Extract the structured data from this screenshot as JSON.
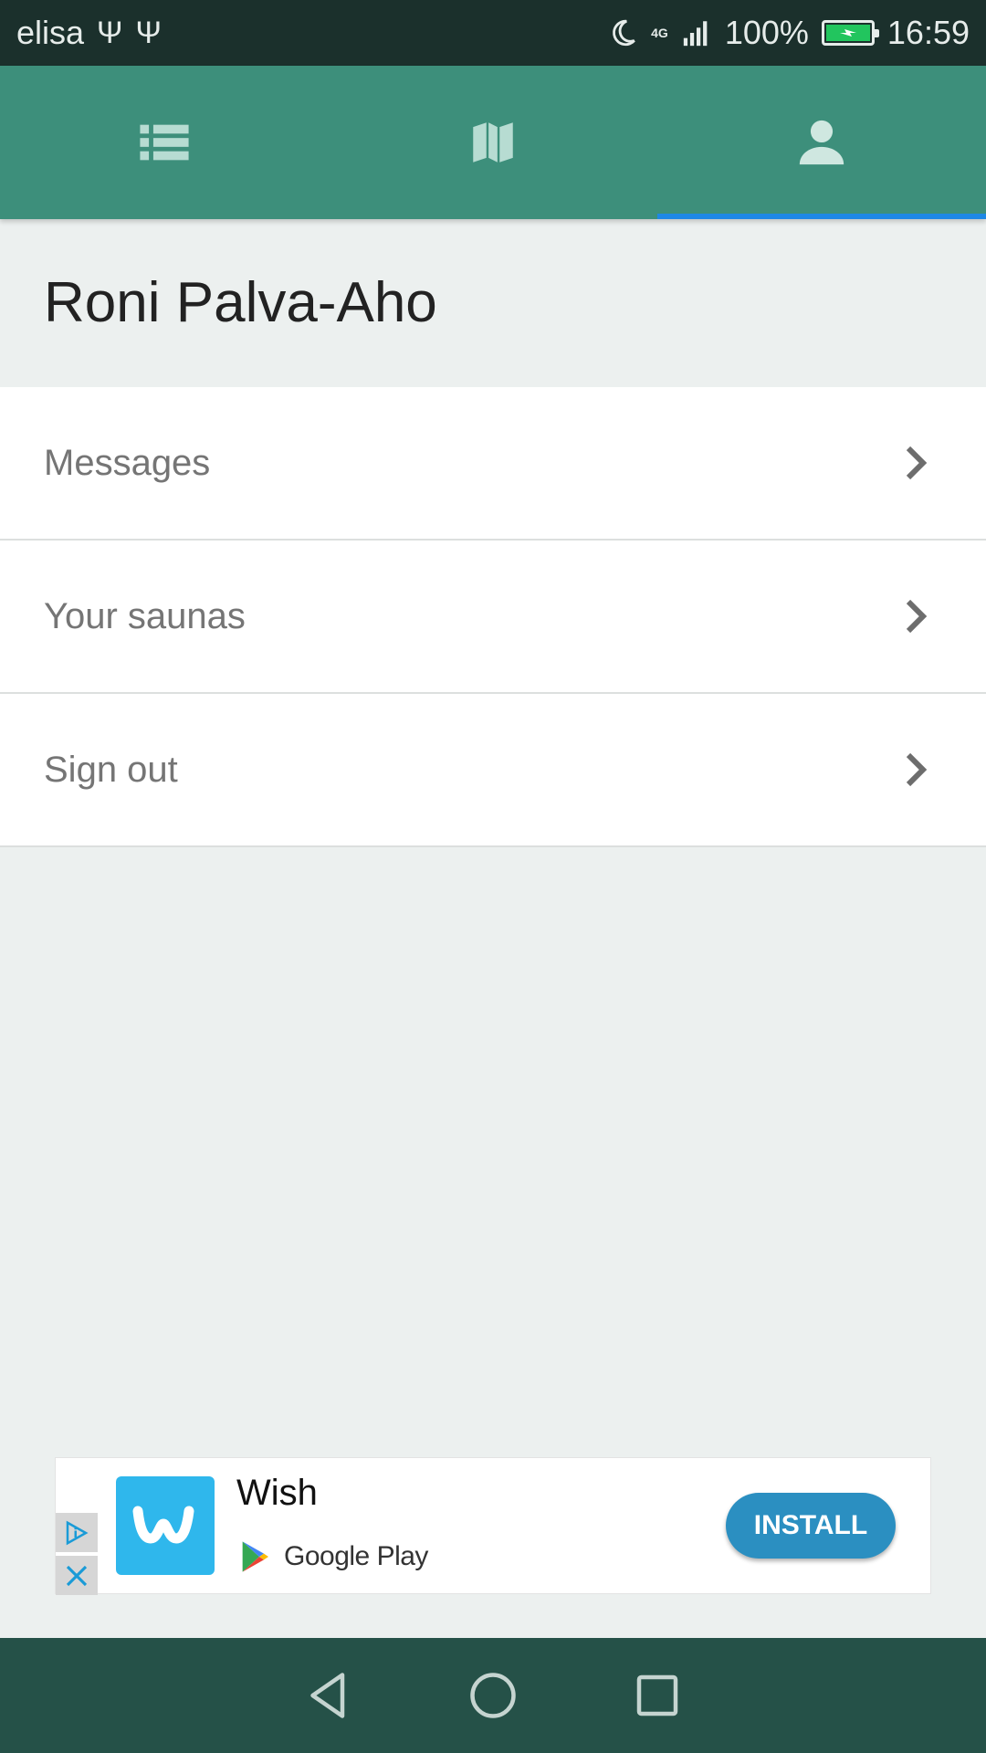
{
  "status_bar": {
    "carrier": "elisa",
    "network": "4G",
    "battery": "100%",
    "time": "16:59"
  },
  "tabs": [
    {
      "icon": "list-icon",
      "active": false
    },
    {
      "icon": "map-icon",
      "active": false
    },
    {
      "icon": "person-icon",
      "active": true
    }
  ],
  "profile": {
    "name": "Roni Palva-Aho"
  },
  "menu": {
    "items": [
      {
        "label": "Messages"
      },
      {
        "label": "Your saunas"
      },
      {
        "label": "Sign out"
      }
    ]
  },
  "ad": {
    "app_name": "Wish",
    "store": "Google Play",
    "button": "INSTALL"
  },
  "colors": {
    "status_bar": "#1b302c",
    "tab_bar": "#3d8f7b",
    "tab_indicator": "#1e88e5",
    "nav_bar": "#255148",
    "install_button": "#2b8fc1",
    "wish_logo": "#2fb7ec"
  }
}
